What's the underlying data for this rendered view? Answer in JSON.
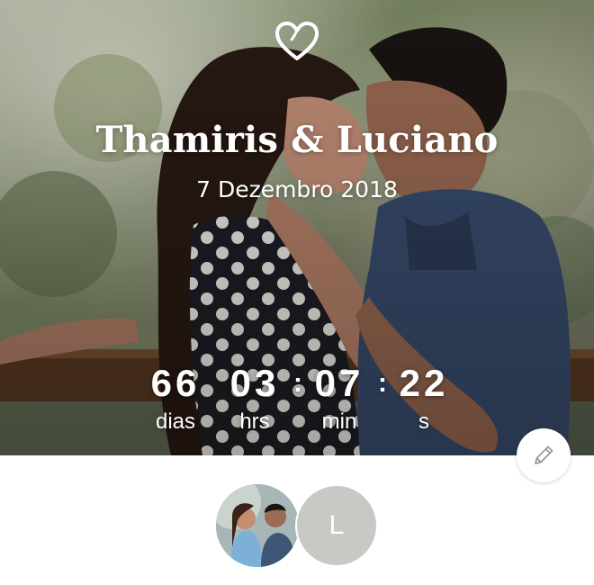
{
  "header": {
    "couple_names": "Thamiris & Luciano",
    "wedding_date": "7 Dezembro 2018",
    "icon": "heart-outline-icon"
  },
  "countdown": {
    "days": {
      "value": "66",
      "label": "dias"
    },
    "hours": {
      "value": "03",
      "label": "hrs"
    },
    "minutes": {
      "value": "07",
      "label": "min"
    },
    "seconds": {
      "value": "22",
      "label": "s"
    },
    "separator": ":"
  },
  "actions": {
    "edit_icon": "pencil-icon"
  },
  "members": [
    {
      "type": "photo",
      "icon": "couple-photo"
    },
    {
      "type": "initial",
      "initial": "L"
    }
  ],
  "colors": {
    "text_on_photo": "#ffffff",
    "initial_avatar_bg": "#c8c9c5",
    "edit_icon": "#9a9a9a"
  }
}
